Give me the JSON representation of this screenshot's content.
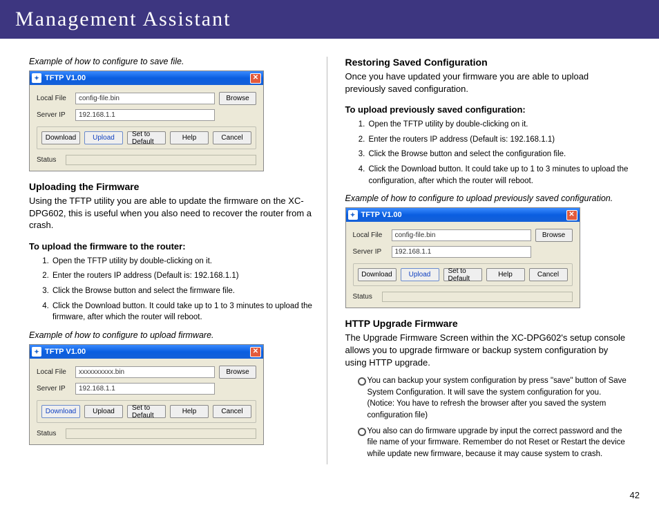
{
  "header": {
    "title": "Management Assistant"
  },
  "page_number": "42",
  "left": {
    "caption1": "Example of how to configure to save file.",
    "dlg1": {
      "title": "TFTP V1.00",
      "local_label": "Local File",
      "local_value": "config-file.bin",
      "server_label": "Server IP",
      "server_value": "192.168.1.1",
      "browse": "Browse",
      "download": "Download",
      "upload": "Upload",
      "set_default": "Set to Default",
      "help": "Help",
      "cancel": "Cancel",
      "status": "Status"
    },
    "h_upload_fw": "Uploading the Firmware",
    "p_upload_fw": "Using the TFTP utility you are able to update the firmware on the XC-DPG602, this is useful when you also need to recover the router from a crash.",
    "subh_upload_fw": "To upload the firmware to the router:",
    "steps_upload_fw": [
      "Open the TFTP utility by double-clicking on it.",
      "Enter the routers IP address (Default is: 192.168.1.1)",
      "Click the Browse button and select the firmware file.",
      "Click the Download button. It could take up to 1 to 3 minutes to upload the firmware, after which the router will reboot."
    ],
    "caption2": "Example of how to configure to upload firmware.",
    "dlg2": {
      "local_value": "xxxxxxxxxx.bin",
      "server_value": "192.168.1.1"
    }
  },
  "right": {
    "h_restore": "Restoring Saved Configuration",
    "p_restore": "Once you have updated your firmware you are able to upload previously saved configuration.",
    "subh_restore": "To upload previously saved configuration:",
    "steps_restore": [
      "Open the TFTP utility by double-clicking on it.",
      "Enter the routers IP address (Default is: 192.168.1.1)",
      "Click the Browse button and select the configuration file.",
      "Click the Download button. It could take up to 1 to 3 minutes to upload the configuration, after which the router will reboot."
    ],
    "caption3": "Example of how to configure to upload previously saved configuration.",
    "dlg3": {
      "local_value": "config-file.bin",
      "server_value": "192.168.1.1"
    },
    "h_http": "HTTP Upgrade Firmware",
    "p_http": "The Upgrade Firmware Screen within the XC-DPG602's setup console allows you to upgrade firmware or backup system configuration by using HTTP upgrade.",
    "bullets_http": [
      "You can backup your system configuration by press \"save\" button of Save System Configuration. It will save the system configuration for you. (Notice: You have to refresh the browser after you saved the system configuration file)",
      "You also can do firmware upgrade by input the correct password and the file name of your firmware. Remember do not Reset or Restart the device while update new firmware, because  it may cause system to crash."
    ]
  }
}
